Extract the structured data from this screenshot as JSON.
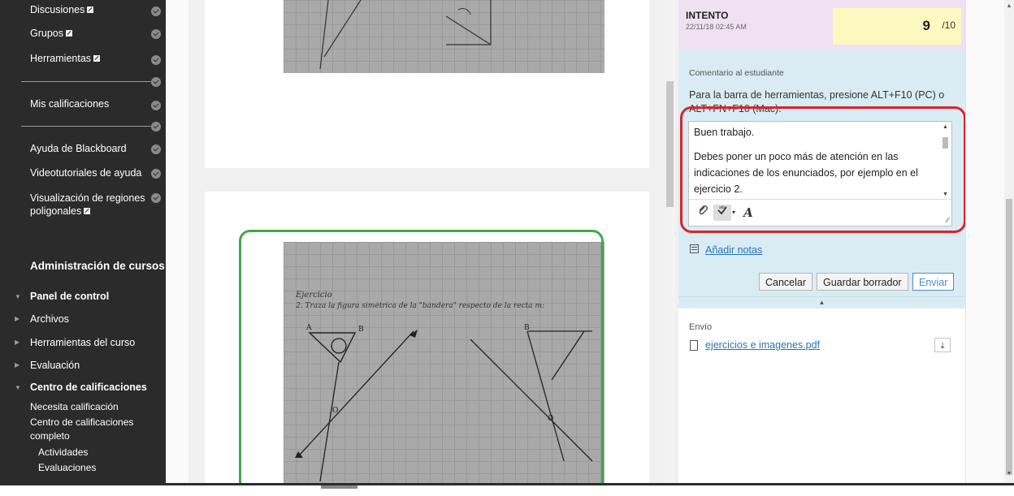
{
  "sidebar": {
    "items": [
      {
        "label": "Discusiones",
        "ext": true
      },
      {
        "label": "Grupos",
        "ext": true
      },
      {
        "label": "Herramientas",
        "ext": true
      },
      {
        "label": "Mis calificaciones",
        "ext": false
      },
      {
        "label": "Ayuda de Blackboard",
        "ext": false
      },
      {
        "label": "Videotutoriales de ayuda",
        "ext": false
      },
      {
        "label": "Visualización de regiones",
        "label2": "poligonales",
        "ext": true
      }
    ],
    "admin_title": "Administración de cursos",
    "admin_nav": [
      {
        "label": "Panel de control",
        "bold": true,
        "expanded": true
      },
      {
        "label": "Archivos",
        "bold": false,
        "expanded": false
      },
      {
        "label": "Herramientas del curso",
        "bold": false,
        "expanded": false
      },
      {
        "label": "Evaluación",
        "bold": false,
        "expanded": false
      },
      {
        "label": "Centro de calificaciones",
        "bold": true,
        "expanded": true
      }
    ],
    "grade_center_items": [
      "Necesita calificación",
      "Centro de calificaciones",
      "completo"
    ],
    "grade_center_sub": [
      "Actividades",
      "Evaluaciones"
    ]
  },
  "attempt": {
    "label": "INTENTO",
    "date": "22/11/18 02:45 AM",
    "score": "9",
    "max": "/10"
  },
  "feedback": {
    "label": "Comentario al estudiante",
    "hint": "Para la barra de herramientas, presione ALT+F10 (PC) o ALT+FN+F10 (Mac).",
    "paragraph1": "Buen trabajo.",
    "paragraph2": "Debes poner un poco más de atención en las indicaciones de los enunciados, por ejemplo en el ejercicio 2.",
    "add_notes": "Añadir notas",
    "cancel_label": "Cancelar",
    "save_draft_label": "Guardar borrador",
    "submit_label": "Enviar"
  },
  "submission": {
    "label": "Envío",
    "file_name": "ejercicios e imagenes.pdf"
  },
  "scan": {
    "line1": "Ejercicio",
    "line2": "2. Traza la figura simétrica de la \"bandera\" respecto de la recta m:"
  },
  "icons": {
    "attach": "paperclip-icon",
    "spellcheck": "spellcheck-icon",
    "format": "text-format-icon",
    "download": "download-icon",
    "file": "file-icon",
    "notes": "notes-icon"
  },
  "colors": {
    "sidebar_bg": "#2b2b2b",
    "attempt_bg": "#efe1f1",
    "score_bg": "#fcf9c0",
    "feedback_bg": "#d9ecf3",
    "link": "#2a74b8",
    "highlight_red": "#d9232e",
    "highlight_green": "#43a84a"
  }
}
